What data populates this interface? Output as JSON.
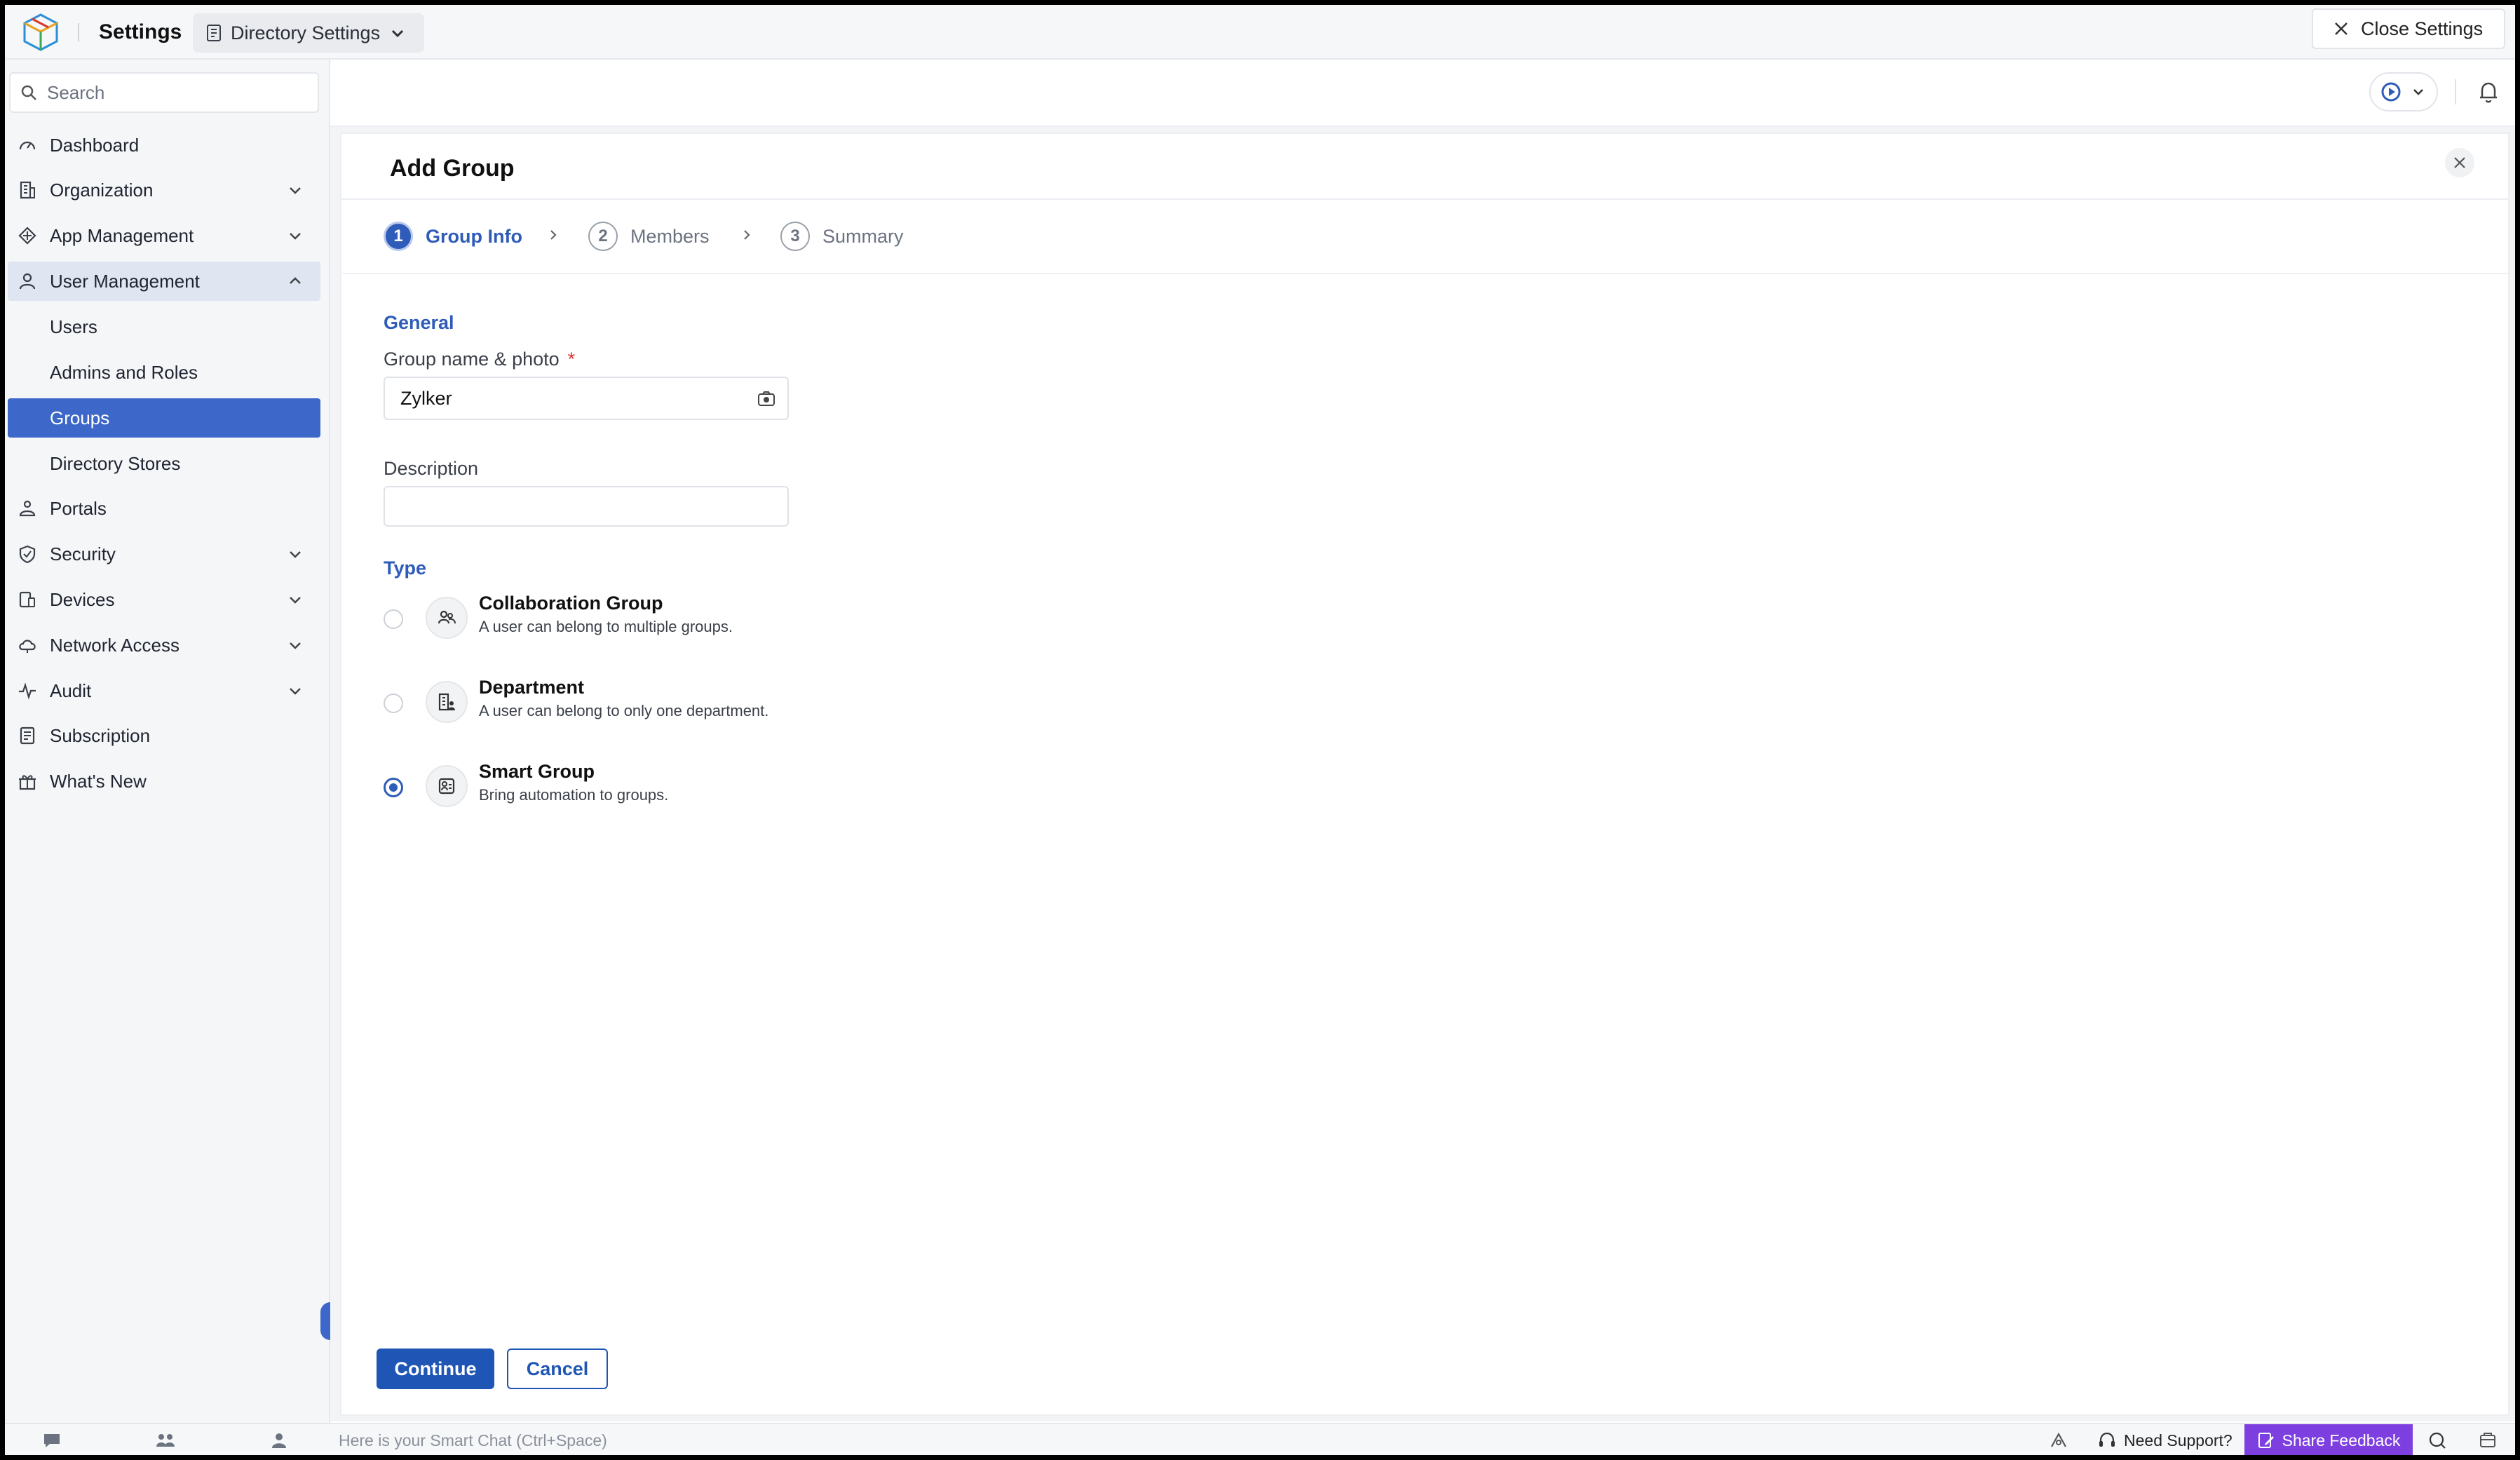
{
  "topbar": {
    "app_title": "Settings",
    "directory_selector": "Directory Settings",
    "close_settings": "Close Settings"
  },
  "sidebar": {
    "search_placeholder": "Search",
    "items": [
      {
        "label": "Dashboard",
        "icon": "dashboard-icon"
      },
      {
        "label": "Organization",
        "icon": "organization-icon"
      },
      {
        "label": "App Management",
        "icon": "app-management-icon"
      },
      {
        "label": "User Management",
        "icon": "user-icon"
      },
      {
        "label": "Users"
      },
      {
        "label": "Admins and Roles"
      },
      {
        "label": "Groups"
      },
      {
        "label": "Directory Stores"
      },
      {
        "label": "Portals",
        "icon": "portals-icon"
      },
      {
        "label": "Security",
        "icon": "shield-icon"
      },
      {
        "label": "Devices",
        "icon": "devices-icon"
      },
      {
        "label": "Network Access",
        "icon": "cloud-icon"
      },
      {
        "label": "Audit",
        "icon": "pulse-icon"
      },
      {
        "label": "Subscription",
        "icon": "receipt-icon"
      },
      {
        "label": "What's New",
        "icon": "gift-icon"
      }
    ]
  },
  "dialog": {
    "title": "Add Group",
    "steps": [
      {
        "num": "1",
        "label": "Group Info"
      },
      {
        "num": "2",
        "label": "Members"
      },
      {
        "num": "3",
        "label": "Summary"
      }
    ],
    "general_heading": "General",
    "name_label": "Group name & photo",
    "required_mark": "*",
    "name_value": "Zylker",
    "description_label": "Description",
    "description_value": "",
    "type_heading": "Type",
    "types": [
      {
        "name": "Collaboration Group",
        "desc": "A user can belong to multiple groups.",
        "selected": false
      },
      {
        "name": "Department",
        "desc": "A user can belong to only one department.",
        "selected": false
      },
      {
        "name": "Smart Group",
        "desc": "Bring automation to groups.",
        "selected": true
      }
    ],
    "continue_label": "Continue",
    "cancel_label": "Cancel"
  },
  "bottombar": {
    "smartchat_hint": "Here is your Smart Chat (Ctrl+Space)",
    "need_support": "Need Support?",
    "share_feedback": "Share Feedback"
  },
  "colors": {
    "accent": "#2f5cb8",
    "active_nav": "#3d68c9",
    "feedback": "#7d3fe0",
    "required": "#e0342f"
  }
}
